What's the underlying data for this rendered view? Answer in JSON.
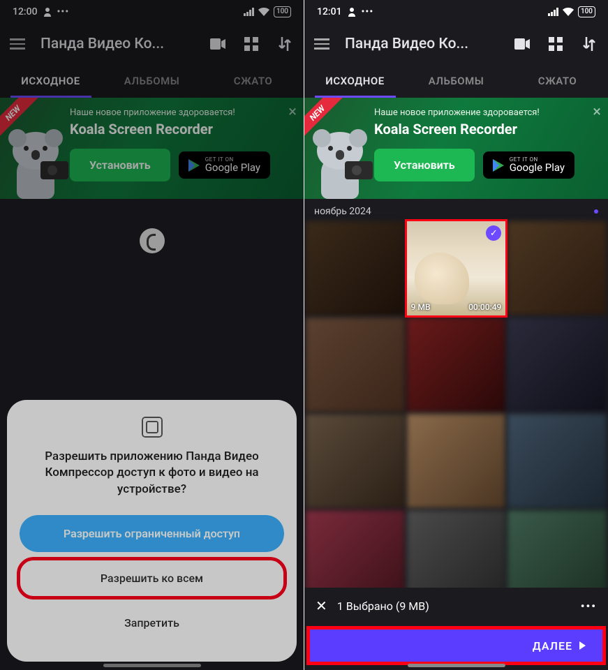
{
  "left": {
    "status": {
      "time": "12:00",
      "battery": "100"
    },
    "app_title": "Панда Видео Ко...",
    "tabs": [
      "ИСХОДНОЕ",
      "АЛЬБОМЫ",
      "СЖАТО"
    ],
    "active_tab": 0,
    "banner": {
      "badge": "NEW",
      "subtitle": "Наше новое приложение здоровается!",
      "title": "Koala Screen Recorder",
      "install": "Установить",
      "store_small": "GET IT ON",
      "store_big": "Google Play"
    },
    "permission": {
      "message": "Разрешить приложению Панда Видео Компрессор доступ к фото и видео на устройстве?",
      "btn_limited": "Разрешить ограниченный доступ",
      "btn_all": "Разрешить ко всем",
      "btn_deny": "Запретить"
    }
  },
  "right": {
    "status": {
      "time": "12:01",
      "battery": "100"
    },
    "app_title": "Панда Видео Ко...",
    "tabs": [
      "ИСХОДНОЕ",
      "АЛЬБОМЫ",
      "СЖАТО"
    ],
    "active_tab": 0,
    "banner": {
      "badge": "NEW",
      "subtitle": "Наше новое приложение здоровается!",
      "title": "Koala Screen Recorder",
      "install": "Установить",
      "store_small": "GET IT ON",
      "store_big": "Google Play"
    },
    "section_date": "ноябрь 2024",
    "selected_thumb": {
      "size": "9 MB",
      "duration": "00:00:49"
    },
    "selection_bar": {
      "count_text": "1 Выбрано (9 MB)"
    },
    "next_button": "ДАЛЕЕ"
  }
}
